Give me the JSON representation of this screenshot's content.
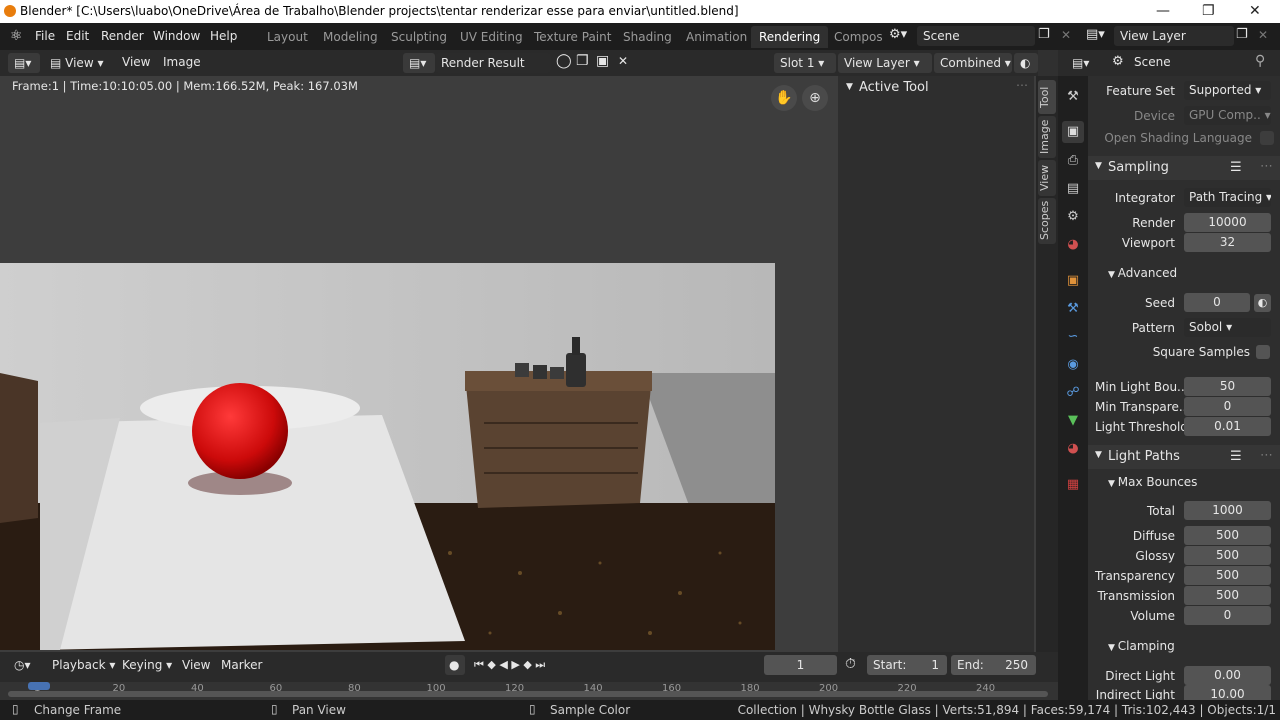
{
  "window": {
    "title": "Blender* [C:\\Users\\luabo\\OneDrive\\Área de Trabalho\\Blender projects\\tentar renderizar esse para enviar\\untitled.blend]"
  },
  "menu": [
    "File",
    "Edit",
    "Render",
    "Window",
    "Help"
  ],
  "workspaces": [
    "Layout",
    "Modeling",
    "Sculpting",
    "UV Editing",
    "Texture Paint",
    "Shading",
    "Animation",
    "Rendering",
    "Compos"
  ],
  "scene": "Scene",
  "view_layer": "View Layer",
  "image_editor": {
    "view": "View",
    "view2": "View",
    "image": "Image",
    "render_result": "Render Result",
    "slot": "Slot 1",
    "layer": "View Layer",
    "pass": "Combined",
    "frame_info": "Frame:1 | Time:10:10:05.00 | Mem:166.52M, Peak: 167.03M",
    "active_tool": "Active Tool",
    "tabs": [
      "Tool",
      "Image",
      "View",
      "Scopes"
    ]
  },
  "properties": {
    "header": "Scene",
    "feature_set_label": "Feature Set",
    "feature_set": "Supported",
    "device_label": "Device",
    "device": "GPU Comp..",
    "osl_label": "Open Shading Language",
    "sampling": "Sampling",
    "integrator_label": "Integrator",
    "integrator": "Path Tracing",
    "render_label": "Render",
    "render": "10000",
    "viewport_label": "Viewport",
    "viewport": "32",
    "advanced": "Advanced",
    "seed_label": "Seed",
    "seed": "0",
    "pattern_label": "Pattern",
    "pattern": "Sobol",
    "square_label": "Square Samples",
    "minlight_label": "Min Light Bou..",
    "minlight": "50",
    "mintrans_label": "Min Transpare..",
    "mintrans": "0",
    "lightthr_label": "Light Threshold",
    "lightthr": "0.01",
    "light_paths": "Light Paths",
    "max_bounces": "Max Bounces",
    "total_label": "Total",
    "total": "1000",
    "diffuse_label": "Diffuse",
    "diffuse": "500",
    "glossy_label": "Glossy",
    "glossy": "500",
    "transparency_label": "Transparency",
    "transparency": "500",
    "transmission_label": "Transmission",
    "transmission": "500",
    "volume_label": "Volume",
    "volume": "0",
    "clamping": "Clamping",
    "direct_label": "Direct Light",
    "direct": "0.00",
    "indirect_label": "Indirect Light",
    "indirect": "10.00"
  },
  "timeline": {
    "playback": "Playback",
    "keying": "Keying",
    "view": "View",
    "marker": "Marker",
    "current": "1",
    "start_label": "Start:",
    "start": "1",
    "end_label": "End:",
    "end": "250",
    "ticks": [
      "1",
      "20",
      "40",
      "60",
      "80",
      "100",
      "120",
      "140",
      "160",
      "180",
      "200",
      "220",
      "240"
    ]
  },
  "status": {
    "change_frame": "Change Frame",
    "pan_view": "Pan View",
    "sample_color": "Sample Color",
    "info": "Collection | Whysky Bottle Glass | Verts:51,894 | Faces:59,174 | Tris:102,443 | Objects:1/1"
  }
}
